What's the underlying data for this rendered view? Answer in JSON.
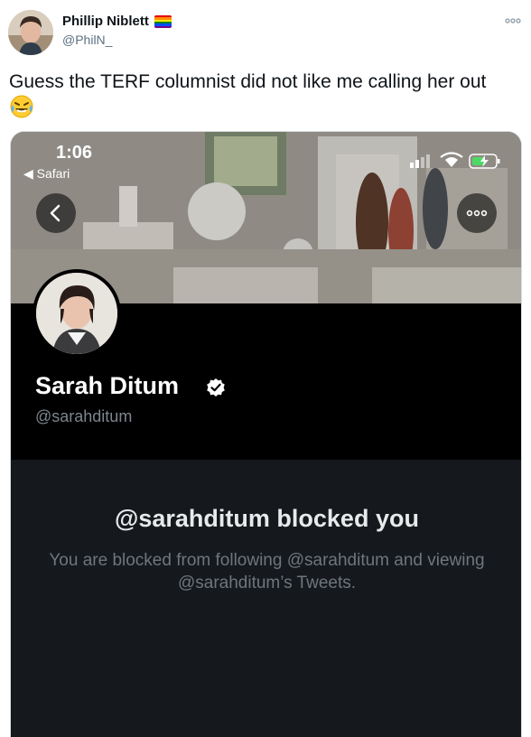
{
  "tweet": {
    "author_name": "Phillip Niblett",
    "author_handle": "@PhilN_",
    "text": "Guess the TERF columnist did not like me calling her out",
    "emoji": "😂",
    "icons": {
      "avatar": "author-avatar",
      "flag": "rainbow-flag-icon",
      "more": "more-options-icon"
    }
  },
  "screenshot": {
    "status_bar": {
      "time": "1:06",
      "back_app": "◀ Safari"
    },
    "profile": {
      "name": "Sarah Ditum",
      "handle": "@sarahditum",
      "verified": true
    },
    "blocked": {
      "title": "@sarahditum blocked you",
      "description": "You are blocked from following @sarahditum and viewing @sarahditum’s Tweets."
    }
  },
  "colors": {
    "text_primary": "#0f1419",
    "text_secondary": "#5b7083",
    "dark_bg": "#15181c",
    "profile_bg": "#000000",
    "battery_green": "#4cd964"
  }
}
